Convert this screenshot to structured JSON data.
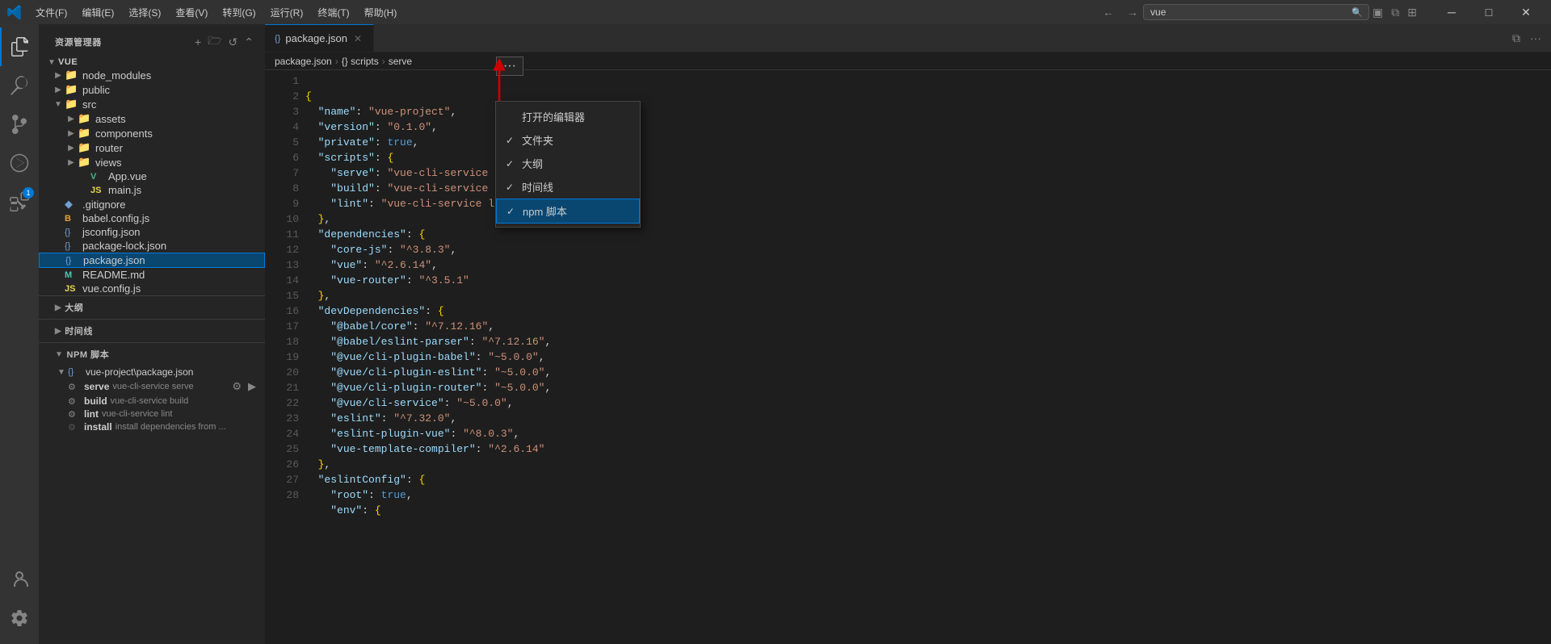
{
  "titlebar": {
    "menus": [
      "文件(F)",
      "编辑(E)",
      "选择(S)",
      "查看(V)",
      "转到(G)",
      "运行(R)",
      "终端(T)",
      "帮助(H)"
    ],
    "search_placeholder": "vue",
    "search_value": "vue"
  },
  "activity_bar": {
    "items": [
      {
        "name": "explorer",
        "icon": "⎇",
        "label": "Explorer",
        "active": true
      },
      {
        "name": "search",
        "icon": "🔍",
        "label": "Search"
      },
      {
        "name": "source-control",
        "icon": "⑂",
        "label": "Source Control"
      },
      {
        "name": "run",
        "icon": "▷",
        "label": "Run"
      },
      {
        "name": "extensions",
        "icon": "⊞",
        "label": "Extensions",
        "badge": "1"
      }
    ]
  },
  "sidebar": {
    "title": "资源管理器",
    "tree": {
      "root": "VUE",
      "items": [
        {
          "id": "node_modules",
          "label": "node_modules",
          "indent": 1,
          "arrow": "▶",
          "icon": "📁"
        },
        {
          "id": "public",
          "label": "public",
          "indent": 1,
          "arrow": "▶",
          "icon": "📁"
        },
        {
          "id": "src",
          "label": "src",
          "indent": 1,
          "arrow": "▼",
          "icon": "📁",
          "expanded": true
        },
        {
          "id": "assets",
          "label": "assets",
          "indent": 2,
          "arrow": "▶",
          "icon": "📁"
        },
        {
          "id": "components",
          "label": "components",
          "indent": 2,
          "arrow": "▶",
          "icon": "📁"
        },
        {
          "id": "router",
          "label": "router",
          "indent": 2,
          "arrow": "▶",
          "icon": "📁"
        },
        {
          "id": "views",
          "label": "views",
          "indent": 2,
          "arrow": "▶",
          "icon": "📁"
        },
        {
          "id": "App.vue",
          "label": "App.vue",
          "indent": 2,
          "icon": "V"
        },
        {
          "id": "main.js",
          "label": "main.js",
          "indent": 2,
          "icon": "JS"
        },
        {
          "id": ".gitignore",
          "label": ".gitignore",
          "indent": 1,
          "icon": "◆"
        },
        {
          "id": "babel.config.js",
          "label": "babel.config.js",
          "indent": 1,
          "icon": "B"
        },
        {
          "id": "jsconfig.json",
          "label": "jsconfig.json",
          "indent": 1,
          "icon": "{}"
        },
        {
          "id": "package-lock.json",
          "label": "package-lock.json",
          "indent": 1,
          "icon": "{}"
        },
        {
          "id": "package.json",
          "label": "package.json",
          "indent": 1,
          "icon": "{}",
          "selected": true
        },
        {
          "id": "README.md",
          "label": "README.md",
          "indent": 1,
          "icon": "M"
        },
        {
          "id": "vue.config.js",
          "label": "vue.config.js",
          "indent": 1,
          "icon": "JS"
        }
      ]
    },
    "sections": {
      "outline": "大纲",
      "timeline": "时间线",
      "npm_scripts": "NPM 脚本"
    },
    "npm_tree": {
      "root_label": "vue-project\\package.json",
      "scripts": [
        {
          "name": "serve",
          "cmd": "vue-cli-service serve"
        },
        {
          "name": "build",
          "cmd": "vue-cli-service build"
        },
        {
          "name": "lint",
          "cmd": "vue-cli-service lint"
        },
        {
          "name": "install",
          "cmd": "install dependencies from ..."
        }
      ]
    }
  },
  "editor": {
    "tab_label": "package.json",
    "breadcrumb": [
      "package.json",
      "{} scripts",
      "serve"
    ],
    "lines": [
      {
        "n": 1,
        "code": ""
      },
      {
        "n": 2,
        "code": "  \"name\": \"vue-project\","
      },
      {
        "n": 3,
        "code": "  \"version\": \"0.1.0\","
      },
      {
        "n": 4,
        "code": "  \"private\": true,"
      },
      {
        "n": 5,
        "code": "  \"scripts\": {"
      },
      {
        "n": 6,
        "code": "    \"serve\": \"vue-cli-service serve\","
      },
      {
        "n": 7,
        "code": "    \"build\": \"vue-cli-service build\","
      },
      {
        "n": 8,
        "code": "    \"lint\": \"vue-cli-service lint\""
      },
      {
        "n": 9,
        "code": "  },"
      },
      {
        "n": 10,
        "code": "  \"dependencies\": {"
      },
      {
        "n": 11,
        "code": "    \"core-js\": \"^3.8.3\","
      },
      {
        "n": 12,
        "code": "    \"vue\": \"^2.6.14\","
      },
      {
        "n": 13,
        "code": "    \"vue-router\": \"^3.5.1\""
      },
      {
        "n": 14,
        "code": "  },"
      },
      {
        "n": 15,
        "code": "  \"devDependencies\": {"
      },
      {
        "n": 16,
        "code": "    \"@babel/core\": \"^7.12.16\","
      },
      {
        "n": 17,
        "code": "    \"@babel/eslint-parser\": \"^7.12.16\","
      },
      {
        "n": 18,
        "code": "    \"@vue/cli-plugin-babel\": \"~5.0.0\","
      },
      {
        "n": 19,
        "code": "    \"@vue/cli-plugin-eslint\": \"~5.0.0\","
      },
      {
        "n": 20,
        "code": "    \"@vue/cli-plugin-router\": \"~5.0.0\","
      },
      {
        "n": 21,
        "code": "    \"@vue/cli-service\": \"~5.0.0\","
      },
      {
        "n": 22,
        "code": "    \"eslint\": \"^7.32.0\","
      },
      {
        "n": 23,
        "code": "    \"eslint-plugin-vue\": \"^8.0.3\","
      },
      {
        "n": 24,
        "code": "    \"vue-template-compiler\": \"^2.6.14\""
      },
      {
        "n": 25,
        "code": "  },"
      },
      {
        "n": 26,
        "code": "  \"eslintConfig\": {"
      },
      {
        "n": 27,
        "code": "    \"root\": true,"
      },
      {
        "n": 28,
        "code": "    \"env\": {"
      }
    ]
  },
  "context_menu": {
    "items": [
      {
        "id": "open_editors",
        "label": "打开的编辑器",
        "checked": false
      },
      {
        "id": "folders",
        "label": "文件夹",
        "checked": true
      },
      {
        "id": "outline",
        "label": "大纲",
        "checked": true
      },
      {
        "id": "timeline",
        "label": "时间线",
        "checked": true
      },
      {
        "id": "npm_scripts",
        "label": "npm 脚本",
        "checked": true
      }
    ]
  },
  "icons": {
    "three_dots": "···",
    "chevron_right": "›",
    "chevron_down": "⌄",
    "close": "✕",
    "check": "✓",
    "gear": "⚙",
    "play": "▶",
    "split": "⧉",
    "more": "···"
  }
}
